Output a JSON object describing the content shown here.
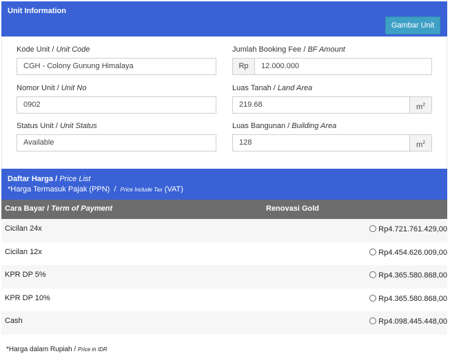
{
  "unit_panel": {
    "title": "Unit Information",
    "gambar_button": "Gambar Unit"
  },
  "fields": {
    "kode_unit": {
      "label": "Kode Unit",
      "label_en": "Unit Code",
      "value": "CGH - Colony Gunung Himalaya"
    },
    "nomor_unit": {
      "label": "Nomor Unit",
      "label_en": "Unit No",
      "value": "0902"
    },
    "status_unit": {
      "label": "Status Unit",
      "label_en": "Unit Status",
      "value": "Available"
    },
    "booking_fee": {
      "label": "Jumlah Booking Fee",
      "label_en": "BF Amount",
      "prefix": "Rp",
      "value": "12.000.000"
    },
    "luas_tanah": {
      "label": "Luas Tanah",
      "label_en": "Land Area",
      "value": "219.68",
      "unit": "m",
      "unit_sup": "2"
    },
    "luas_bangunan": {
      "label": "Luas Bangunan",
      "label_en": "Building Area",
      "value": "128",
      "unit": "m",
      "unit_sup": "2"
    }
  },
  "price_panel": {
    "title": "Daftar Harga",
    "title_en": "Price List",
    "tax_note": "*Harga Termasuk Pajak (PPN)",
    "tax_note_en": "Price Include Tax",
    "tax_note_vat": "(VAT)"
  },
  "table": {
    "col_term": "Cara Bayar",
    "col_term_en": "Term of Payment",
    "col_option": "Renovasi Gold",
    "rows": [
      {
        "term": "Cicilan 24x",
        "price": "Rp4.721.761.429,00"
      },
      {
        "term": "Cicilan 12x",
        "price": "Rp4.454.626.009,00"
      },
      {
        "term": "KPR DP 5%",
        "price": "Rp4.365.580.868,00"
      },
      {
        "term": "KPR DP 10%",
        "price": "Rp4.365.580.868,00"
      },
      {
        "term": "Cash",
        "price": "Rp4.098.445.448,00"
      }
    ]
  },
  "footnote": {
    "text": "*Harga dalam Rupiah /",
    "text_en": "Price in IDR"
  },
  "colors": {
    "header_blue": "#3a62d6",
    "button_teal": "#3fa0c5",
    "table_head_gray": "#6d6d6d"
  }
}
